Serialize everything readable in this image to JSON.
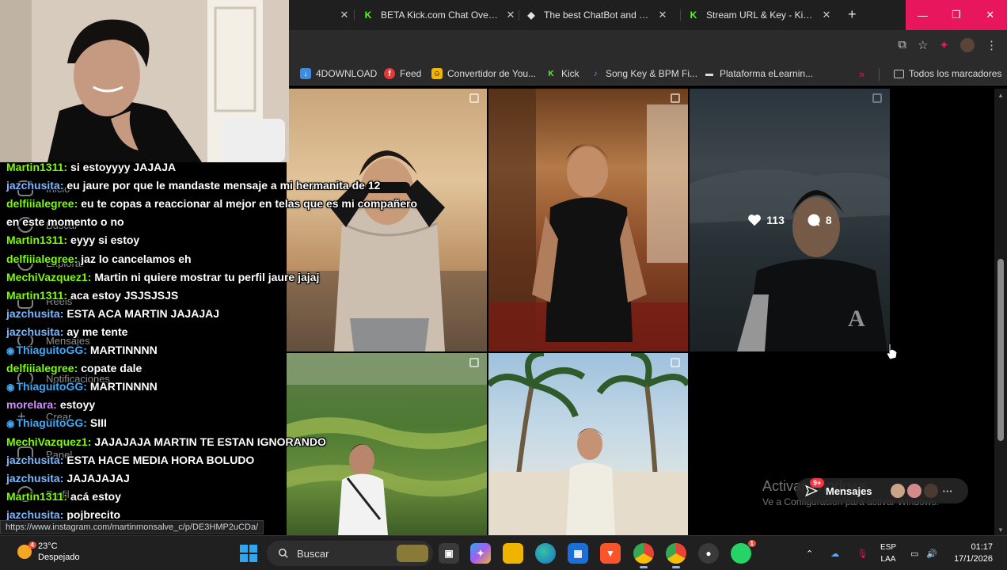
{
  "browser": {
    "tabs": [
      {
        "title": "",
        "favicon": "none"
      },
      {
        "title": "BETA Kick.com Chat Overlay",
        "favicon": "kick-logo"
      },
      {
        "title": "The best ChatBot and Widg",
        "favicon": "chatbot-logo"
      },
      {
        "title": "Stream URL & Key - Kick Da",
        "favicon": "kick-logo"
      }
    ],
    "new_tab_glyph": "+",
    "window_controls": {
      "minimize": "—",
      "maximize": "❐",
      "close": "✕"
    },
    "tab_close_glyph": "✕",
    "bookmarks": [
      {
        "label": "4DOWNLOAD",
        "icon": "4download-icon",
        "color": "#3b8de0"
      },
      {
        "label": "Feed",
        "icon": "feed-icon",
        "color": "#e53935"
      },
      {
        "label": "Convertidor de You...",
        "icon": "converter-icon",
        "color": "#f5b400"
      },
      {
        "label": "Kick",
        "icon": "kick-icon",
        "color": "#53fc18"
      },
      {
        "label": "Song Key & BPM Fi...",
        "icon": "song-key-icon",
        "color": "#6c5ce7"
      },
      {
        "label": "Plataforma eLearnin...",
        "icon": "elearning-icon",
        "color": "#dddddd"
      }
    ],
    "bookmarks_overflow": "»",
    "all_bookmarks": "Todos los marcadores",
    "status_url": "https://www.instagram.com/martinmonsalve_c/p/DE3HMP2uCDa/"
  },
  "instagram": {
    "hover_stats": {
      "likes": "113",
      "comments": "8"
    },
    "messages_pill": {
      "label": "Mensajes",
      "badge": "9+"
    },
    "nav_items": [
      "Inicio",
      "Buscar",
      "Explorar",
      "Reels",
      "Mensajes",
      "Notificaciones",
      "Crear",
      "Panel",
      "Perfil"
    ]
  },
  "windows_watermark": {
    "line1": "Activar Windows",
    "line2": "Ve a Configuración para activar Windows."
  },
  "chat": [
    {
      "user": "Martin1311:",
      "color": "#7cfc00",
      "msg": "si estoyyyy JAJAJA"
    },
    {
      "user": "jazchusita:",
      "color": "#7ab8ff",
      "msg": "eu jaure por que le mandaste mensaje a mi hermanita de 12"
    },
    {
      "user": "delfiiialegree:",
      "color": "#7cfc00",
      "msg": "eu te copas a reaccionar al mejor en telas que es mi compañero"
    },
    {
      "user": "",
      "color": "#ffffff",
      "msg": "en este momento o no"
    },
    {
      "user": "Martin1311:",
      "color": "#7cfc00",
      "msg": "eyyy si estoy"
    },
    {
      "user": "delfiiialegree:",
      "color": "#7cfc00",
      "msg": "jaz lo cancelamos eh"
    },
    {
      "user": "MechiVazquez1:",
      "color": "#7cfc00",
      "msg": "Martin ni quiere mostrar tu perfil jaure jajaj"
    },
    {
      "user": "Martin1311:",
      "color": "#7cfc00",
      "msg": "aca estoy JSJSJSJS"
    },
    {
      "user": "jazchusita:",
      "color": "#7ab8ff",
      "msg": "ESTA ACA MARTIN JAJAJAJ"
    },
    {
      "user": "jazchusita:",
      "color": "#7ab8ff",
      "msg": "ay me tente"
    },
    {
      "user": "ThiaguitoGG:",
      "color": "#3fa9f5",
      "msg": "MARTINNNN",
      "badge": true
    },
    {
      "user": "delfiiialegree:",
      "color": "#7cfc00",
      "msg": "copate dale"
    },
    {
      "user": "ThiaguitoGG:",
      "color": "#3fa9f5",
      "msg": "MARTINNNN",
      "badge": true
    },
    {
      "user": "morelara:",
      "color": "#d18cff",
      "msg": "estoyy"
    },
    {
      "user": "ThiaguitoGG:",
      "color": "#3fa9f5",
      "msg": "SIII",
      "badge": true
    },
    {
      "user": "MechiVazquez1:",
      "color": "#7cfc00",
      "msg": "JAJAJAJA MARTIN TE ESTAN IGNORANDO"
    },
    {
      "user": "jazchusita:",
      "color": "#7ab8ff",
      "msg": "ESTA HACE MEDIA HORA BOLUDO"
    },
    {
      "user": "jazchusita:",
      "color": "#7ab8ff",
      "msg": "JAJAJAJAJ"
    },
    {
      "user": "Martin1311:",
      "color": "#7cfc00",
      "msg": "acá estoy"
    },
    {
      "user": "jazchusita:",
      "color": "#7ab8ff",
      "msg": "pojbrecito"
    }
  ],
  "taskbar": {
    "weather_temp": "23°C",
    "weather_desc": "Despejado",
    "weather_badge": "4",
    "search_placeholder": "Buscar",
    "lang_top": "ESP",
    "lang_bottom": "LAA",
    "time": "01:17",
    "date": "17/1/2026",
    "whatsapp_badge": "1"
  }
}
